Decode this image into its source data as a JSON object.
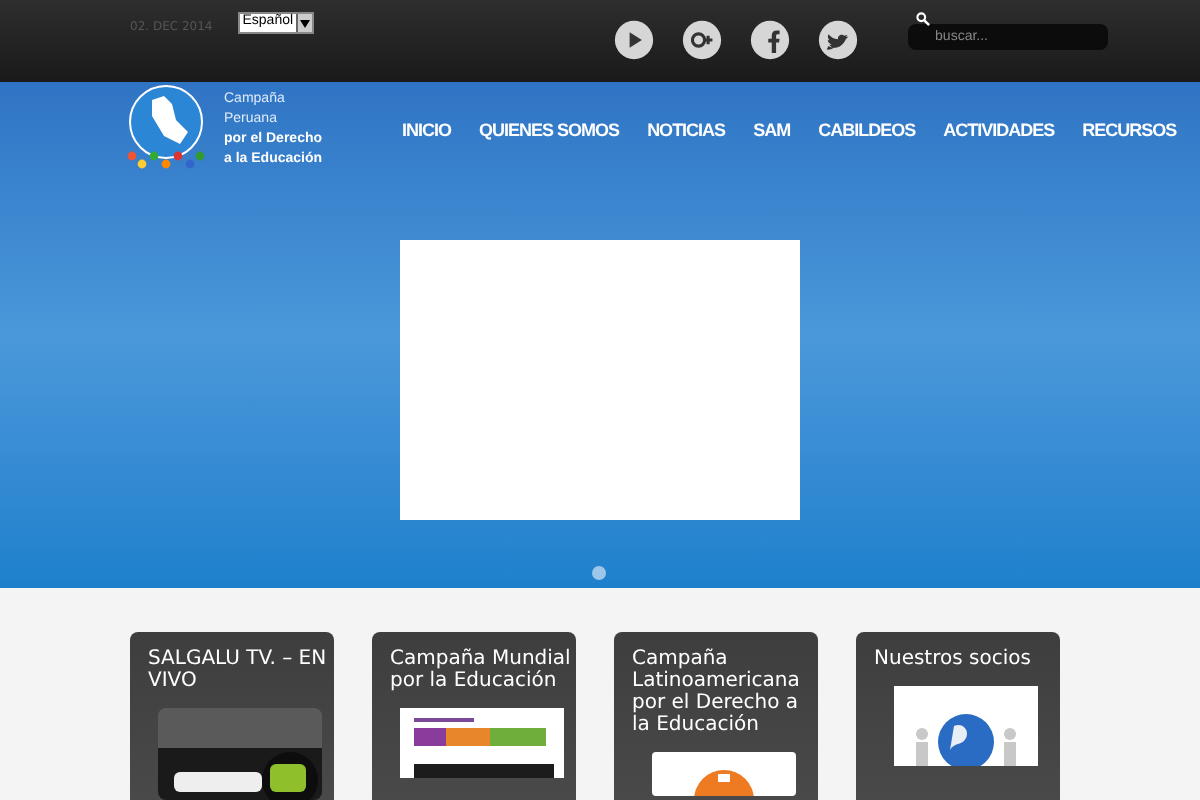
{
  "topbar": {
    "date": "02. DEC 2014",
    "language": "Español",
    "search": {
      "placeholder": "buscar..."
    }
  },
  "logo": {
    "line_1": "Campaña",
    "line_2": "Peruana",
    "line_3": "por el Derecho",
    "line_4": "a la Educación"
  },
  "nav": [
    {
      "label": "INICIO"
    },
    {
      "label": "QUIENES SOMOS"
    },
    {
      "label": "NOTICIAS"
    },
    {
      "label": "SAM"
    },
    {
      "label": "CABILDEOS"
    },
    {
      "label": "ACTIVIDADES"
    },
    {
      "label": "RECURSOS"
    }
  ],
  "slider": {
    "dots": [
      {
        "selected": true
      }
    ]
  },
  "cards": [
    {
      "title": "SALGALU TV. – EN VIVO",
      "kind": "tv"
    },
    {
      "title": "Campaña Mundial por la Educación",
      "kind": "poster"
    },
    {
      "title": "Campaña Latinoamericana por el Derecho a la Educación",
      "kind": "round"
    },
    {
      "title": "Nuestros socios",
      "kind": "globe"
    }
  ]
}
